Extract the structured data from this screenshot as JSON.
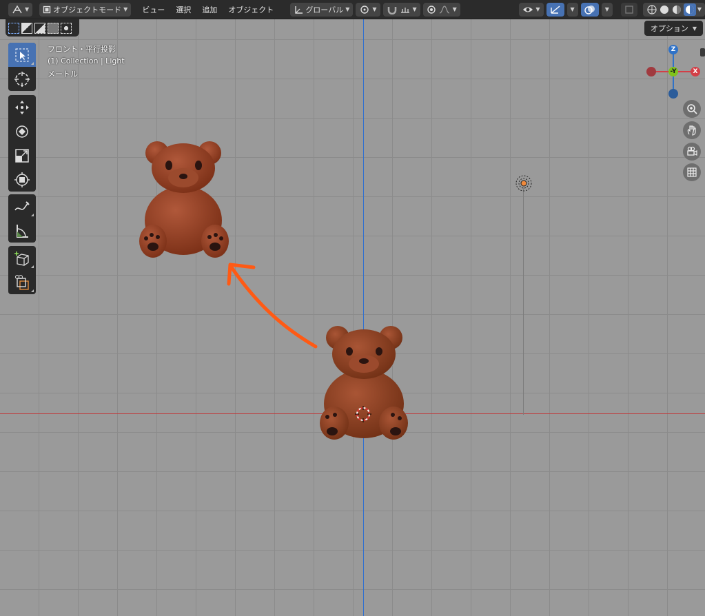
{
  "header": {
    "editor_type_icon": "viewport-icon",
    "mode_label": "オブジェクトモード",
    "menus": [
      "ビュー",
      "選択",
      "追加",
      "オブジェクト"
    ],
    "transform_orientation": "グローバル",
    "pivot_icon": "pivot-icon",
    "snap_icon": "snap-magnet-icon",
    "proportional_icon": "proportional-edit-icon"
  },
  "options_label": "オプション",
  "overlay_text": {
    "view_name": "フロント・平行投影",
    "collection_line": "(1) Collection | Light",
    "units": "メートル"
  },
  "gizmo": {
    "z_label": "Z",
    "y_label": "-Y",
    "x_label": "X",
    "colors": {
      "x": "#d33f47",
      "y": "#80c21c",
      "z": "#2f72c7"
    }
  },
  "toolbar": {
    "tools": [
      "select-box-icon",
      "cursor-icon",
      "move-icon",
      "rotate-icon",
      "scale-icon",
      "transform-icon",
      "annotate-icon",
      "measure-icon",
      "add-cube-icon",
      "extract-icon"
    ]
  },
  "annotation": {
    "arrow_color": "#ff5a14"
  },
  "object_color": "#8e3b20"
}
